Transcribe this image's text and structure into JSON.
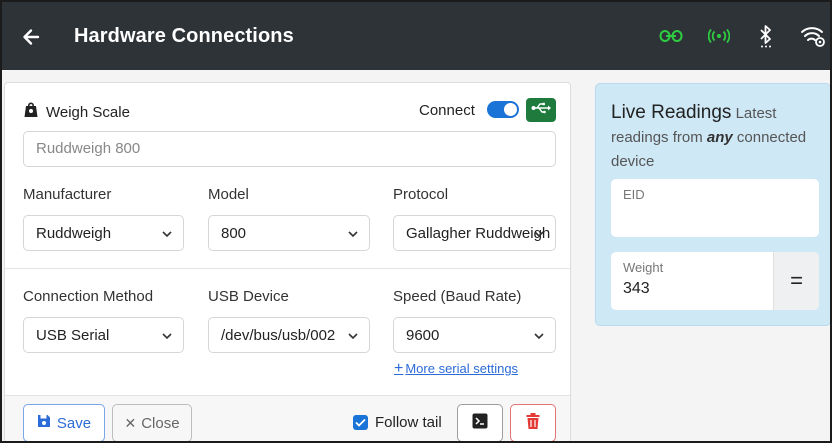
{
  "header": {
    "title": "Hardware Connections",
    "icons": [
      "back-arrow-icon",
      "link-icon",
      "broadcast-icon",
      "bluetooth-icon",
      "wifi-settings-icon"
    ],
    "accent_green": "#2ecc40"
  },
  "device": {
    "section_label": "Weigh Scale",
    "connect_label": "Connect",
    "connected": true,
    "name_value": "Ruddweigh 800",
    "manufacturer_label": "Manufacturer",
    "manufacturer_value": "Ruddweigh",
    "model_label": "Model",
    "model_value": "800",
    "protocol_label": "Protocol",
    "protocol_value": "Gallagher Ruddweigh",
    "connection_method_label": "Connection Method",
    "connection_method_value": "USB Serial",
    "usb_device_label": "USB Device",
    "usb_device_value": "/dev/bus/usb/002",
    "speed_label": "Speed (Baud Rate)",
    "speed_value": "9600",
    "more_serial_settings": "More serial settings"
  },
  "footer": {
    "save_label": "Save",
    "close_label": "Close",
    "follow_tail_label": "Follow tail",
    "follow_tail_checked": true
  },
  "live": {
    "title": "Live Readings",
    "subtitle_pre": "Latest readings from ",
    "subtitle_em": "any",
    "subtitle_post": " connected device",
    "eid_label": "EID",
    "eid_value": "",
    "weight_label": "Weight",
    "weight_value": "343",
    "equals_label": "="
  },
  "colors": {
    "topbar": "#2e3338",
    "primary": "#1a73d6",
    "usb_green": "#1f7a3d",
    "danger": "#e53935",
    "live_bg": "#cfe8f6"
  }
}
